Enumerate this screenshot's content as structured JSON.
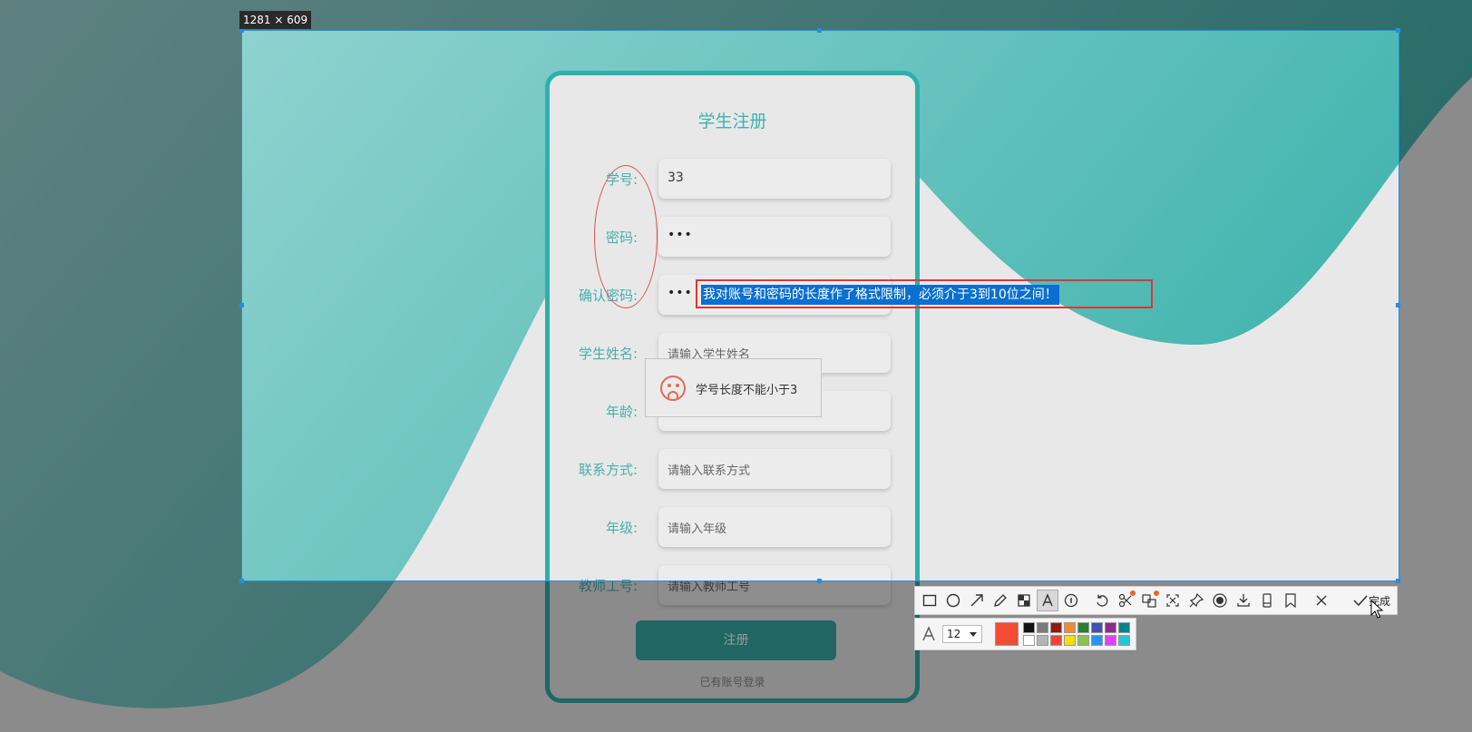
{
  "screenshot_overlay": {
    "dimensions_label": "1281 × 609"
  },
  "form": {
    "title": "学生注册",
    "fields": [
      {
        "label": "学号:",
        "value": "33",
        "placeholder": ""
      },
      {
        "label": "密码:",
        "value": "•••",
        "placeholder": ""
      },
      {
        "label": "确认密码:",
        "value": "•••",
        "placeholder": ""
      },
      {
        "label": "学生姓名:",
        "value": "",
        "placeholder": "请输入学生姓名"
      },
      {
        "label": "年龄:",
        "value": "",
        "placeholder": ""
      },
      {
        "label": "联系方式:",
        "value": "",
        "placeholder": "请输入联系方式"
      },
      {
        "label": "年级:",
        "value": "",
        "placeholder": "请输入年级"
      },
      {
        "label": "教师工号:",
        "value": "",
        "placeholder": "请输入教师工号"
      }
    ],
    "submit_label": "注册",
    "login_link": "已有账号登录"
  },
  "toast": {
    "icon": "sad-face-icon",
    "message": "学号长度不能小于3"
  },
  "annotation": {
    "text": "我对账号和密码的长度作了格式限制，必须介于3到10位之间！",
    "color": "#e03535"
  },
  "toolbar": {
    "tools": [
      "rectangle-icon",
      "ellipse-icon",
      "arrow-icon",
      "pencil-icon",
      "mosaic-icon",
      "text-icon",
      "serial-number-icon",
      "undo-icon",
      "ocr-icon",
      "translate-icon",
      "scroll-capture-icon",
      "pin-icon",
      "record-icon",
      "save-icon",
      "long-screenshot-icon",
      "bookmark-icon",
      "close-icon",
      "check-icon"
    ],
    "done_label": "完成"
  },
  "text_options": {
    "font_size": "12",
    "current_color": "#f44b35",
    "swatches": [
      "#111111",
      "#7a7a7a",
      "#8c1c14",
      "#ef8a3a",
      "#2e7d32",
      "#3f51b5",
      "#8e2c8e",
      "#00838f",
      "#ffffff",
      "#b5b5b5",
      "#f44336",
      "#f5e000",
      "#8bc34a",
      "#2196f3",
      "#e040fb",
      "#26c6da"
    ]
  },
  "colors": {
    "accent": "#2fb0ab",
    "selection_border": "#1e90e8",
    "highlight": "#0a6fd1"
  }
}
